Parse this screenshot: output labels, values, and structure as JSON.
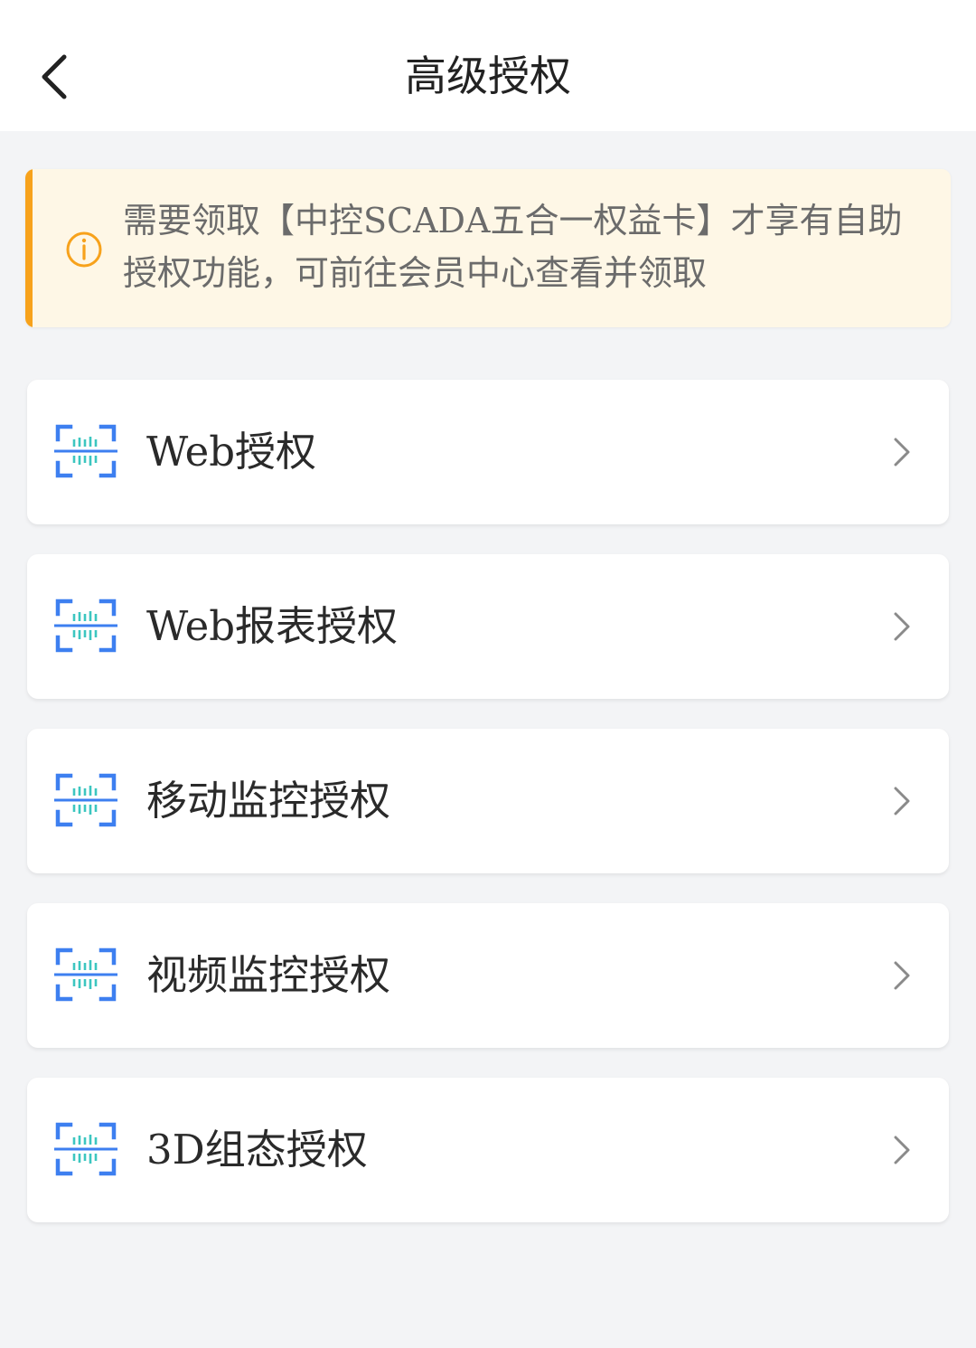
{
  "header": {
    "title": "高级授权",
    "back_icon": "chevron-left-icon"
  },
  "notice": {
    "icon": "info-icon",
    "text": "需要领取【中控SCADA五合一权益卡】才享有自助授权功能，可前往会员中心查看并领取",
    "colors": {
      "accent": "#f7a21b",
      "background": "#fef7e6"
    }
  },
  "items": [
    {
      "label": "Web授权",
      "icon": "scan-barcode-icon"
    },
    {
      "label": "Web报表授权",
      "icon": "scan-barcode-icon"
    },
    {
      "label": "移动监控授权",
      "icon": "scan-barcode-icon"
    },
    {
      "label": "视频监控授权",
      "icon": "scan-barcode-icon"
    },
    {
      "label": "3D组态授权",
      "icon": "scan-barcode-icon"
    }
  ],
  "colors": {
    "icon_blue": "#3d7ff0",
    "icon_teal": "#3cc6c0",
    "page_bg": "#f3f4f6"
  }
}
